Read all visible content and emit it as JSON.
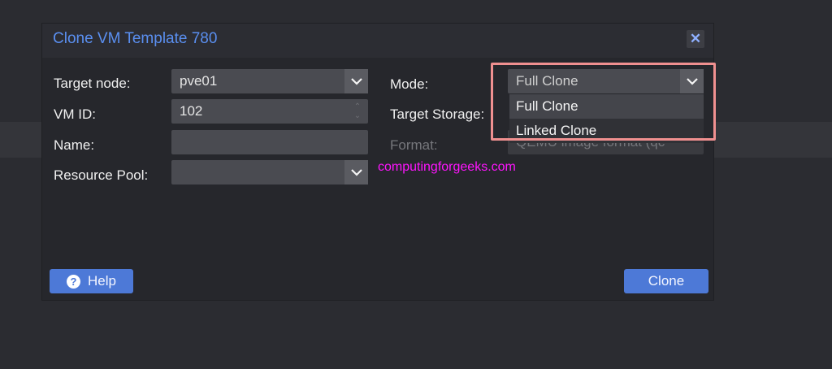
{
  "dialog": {
    "title": "Clone VM Template 780",
    "close_icon": "close-icon"
  },
  "form": {
    "target_node_label": "Target node:",
    "target_node_value": "pve01",
    "vm_id_label": "VM ID:",
    "vm_id_value": "102",
    "name_label": "Name:",
    "name_value": "",
    "resource_pool_label": "Resource Pool:",
    "resource_pool_value": "",
    "mode_label": "Mode:",
    "mode_value": "Full Clone",
    "target_storage_label": "Target Storage:",
    "format_label": "Format:",
    "format_value": "QEMU image format (qc"
  },
  "mode_dropdown": {
    "options": [
      "Full Clone",
      "Linked Clone"
    ],
    "selected": "Full Clone"
  },
  "watermark": "computingforgeeks.com",
  "buttons": {
    "help_label": "Help",
    "clone_label": "Clone"
  },
  "colors": {
    "accent": "#4d79d7",
    "title": "#5a8ff0",
    "highlight_border": "#f09090",
    "watermark": "#ff14ff"
  }
}
